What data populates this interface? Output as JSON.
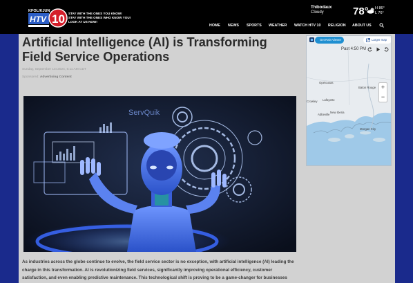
{
  "site": {
    "logo_text": "HTV 10",
    "logo_small_text": "KFOL/KJUN",
    "tagline_lines": [
      "STAY WITH THE ONES YOU KNOW!",
      "STAY WITH THE ONES WHO KNOW YOU!",
      "LOOK AT US NOW!"
    ]
  },
  "weather": {
    "location": "Thibodaux",
    "condition": "Cloudy",
    "temp": "78°",
    "icon": "partly-cloudy-icon",
    "high": "H 86°",
    "low": "L 76°"
  },
  "nav": {
    "items": [
      "HOME",
      "NEWS",
      "SPORTS",
      "WEATHER",
      "WATCH HTV 10",
      "RELIGION",
      "ABOUT US"
    ]
  },
  "article": {
    "title": "Artificial Intelligence (AI) is Transforming Field Service Operations",
    "dateline": "Sunday, September 1st 2024, 5:11 AM CDT",
    "sponsored_label": "Sponsored:",
    "sponsored_value": "Advertising Content",
    "image_brand": "ServQuik",
    "body": "As industries across the globe continue to evolve, the field service sector is no exception, with artificial intelligence (AI) leading the charge in this transformation. AI is revolutionizing field services, significantly improving operational efficiency, customer satisfaction, and even enabling predictive maintenance. This technological shift is proving to be a game-changer for businesses"
  },
  "map": {
    "rain_viewer_label": "Get Rain Viewer",
    "larger_map_label": "Larger map",
    "time_label": "Past 4:50 PM",
    "zoom_in": "+",
    "zoom_out": "−",
    "cities": [
      "Opelousas",
      "Baton Rouge",
      "Crowley",
      "Lafayette",
      "Abbeville",
      "New Iberia",
      "Morgan City"
    ]
  },
  "colors": {
    "page_background": "#1a2a8c",
    "header": "#000000",
    "content": "#d2d2d2",
    "rain_viewer_button": "#1f8fd1"
  }
}
